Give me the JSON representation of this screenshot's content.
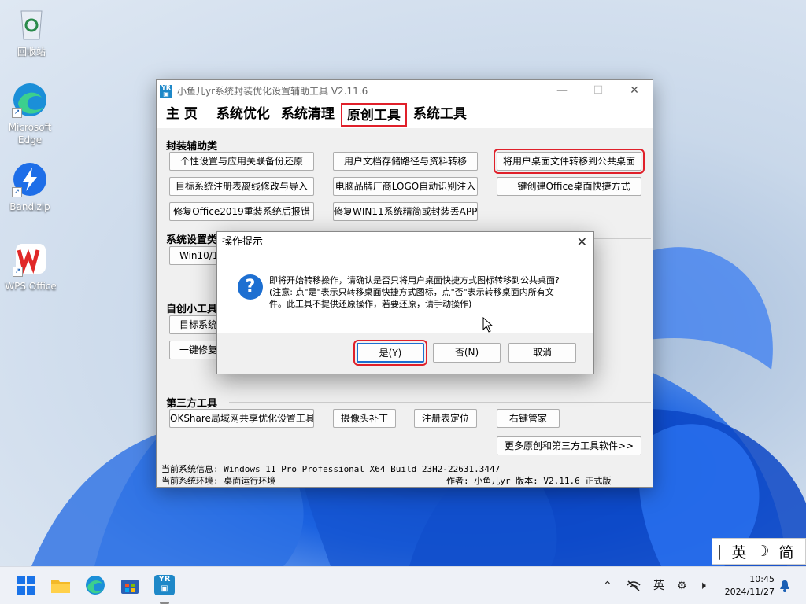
{
  "desktop": {
    "icons": [
      {
        "label": "回收站",
        "icon": "recycle-bin-icon"
      },
      {
        "label": "Microsoft\nEdge",
        "icon": "edge-icon"
      },
      {
        "label": "Bandizip",
        "icon": "bandizip-icon"
      },
      {
        "label": "WPS Office",
        "icon": "wps-icon"
      }
    ]
  },
  "app": {
    "title": "小鱼儿yr系统封装优化设置辅助工具 V2.11.6",
    "tabs": [
      "主 页",
      "系统优化",
      "系统清理",
      "原创工具",
      "系统工具"
    ],
    "active_tab": "原创工具",
    "groups": {
      "packaging": {
        "title": "封装辅助类",
        "buttons": [
          "个性设置与应用关联备份还原",
          "用户文档存储路径与资料转移",
          "将用户桌面文件转移到公共桌面",
          "目标系统注册表离线修改与导入",
          "电脑品牌厂商LOGO自动识别注入",
          "一键创建Office桌面快捷方式",
          "修复Office2019重装系统后报错",
          "修复WIN11系统精简或封装丢APP"
        ]
      },
      "system_settings": {
        "title": "系统设置类",
        "buttons": [
          "Win10/11"
        ]
      },
      "custom_tools": {
        "title": "自创小工具",
        "buttons": [
          "目标系统",
          "一键修复"
        ]
      },
      "third_party": {
        "title": "第三方工具",
        "buttons": [
          "OKShare局域网共享优化设置工具",
          "摄像头补丁",
          "注册表定位",
          "右键管家"
        ],
        "more": "更多原创和第三方工具软件>>"
      }
    },
    "status": {
      "sysinfo": "当前系统信息: Windows 11 Pro Professional X64 Build 23H2-22631.3447",
      "env": "当前系统环境: 桌面运行环境",
      "author": "作者: 小鱼儿yr  版本: V2.11.6 正式版"
    }
  },
  "dialog": {
    "title": "操作提示",
    "icon": "question-icon",
    "line1": "即将开始转移操作，请确认是否只将用户桌面快捷方式图标转移到公共桌面?",
    "line2": "(注意: 点\"是\"表示只转移桌面快捷方式图标，点\"否\"表示转移桌面内所有文",
    "line3": "件。此工具不提供还原操作，若要还原，请手动操作)",
    "yes": "是(Y)",
    "no": "否(N)",
    "cancel": "取消"
  },
  "ime": {
    "lang": "英",
    "mode": "简"
  },
  "taskbar": {
    "tray_lang": "英",
    "time": "10:45",
    "date": "2024/11/27"
  },
  "colors": {
    "highlight": "#e0202a",
    "accent": "#1d6fd1"
  }
}
